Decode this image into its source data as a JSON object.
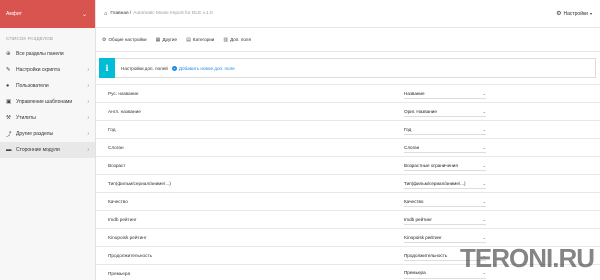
{
  "sidebar": {
    "brand": "Амфит",
    "caption": "СПИСОК РАЗДЕЛОВ",
    "items": [
      {
        "icon": "globe-icon",
        "glyph": "⊕",
        "label": "Все разделы панели",
        "arrow": ""
      },
      {
        "icon": "wrench-icon",
        "glyph": "✎",
        "label": "Настройки скрипта",
        "arrow": "›"
      },
      {
        "icon": "user-icon",
        "glyph": "●",
        "label": "Пользователи",
        "arrow": "›"
      },
      {
        "icon": "templates-icon",
        "glyph": "▣",
        "label": "Управление шаблонами",
        "arrow": "›"
      },
      {
        "icon": "tools-icon",
        "glyph": "⚒",
        "label": "Утилиты",
        "arrow": "›"
      },
      {
        "icon": "share-icon",
        "glyph": "⤴",
        "label": "Другие разделы",
        "arrow": "›"
      },
      {
        "icon": "module-icon",
        "glyph": "▬",
        "label": "Сторонние модули",
        "arrow": "›"
      }
    ]
  },
  "topbar": {
    "crumb_home": "Главная /",
    "crumb_current": "Automatic Movie Import for DLE v.1.0",
    "settings_label": "Настройки"
  },
  "tabs": [
    {
      "icon": "gear-icon",
      "glyph": "⚙",
      "label": "Общие настройки"
    },
    {
      "icon": "grid-icon",
      "glyph": "▦",
      "label": "Другие"
    },
    {
      "icon": "list-icon",
      "glyph": "▤",
      "label": "Категории"
    },
    {
      "icon": "fields-icon",
      "glyph": "▥",
      "label": "Доп. поля"
    }
  ],
  "info": {
    "text": "Настройки доп. полей",
    "link": "Добавить новое доп. поле"
  },
  "rows": [
    {
      "label": "Рус. название",
      "value": "Название"
    },
    {
      "label": "Англ. название",
      "value": "Ориг. Название"
    },
    {
      "label": "Год",
      "value": "Год"
    },
    {
      "label": "Слоган",
      "value": "Слоган"
    },
    {
      "label": "Возраст",
      "value": "Возрастные ограничения"
    },
    {
      "label": "Тип(фильм/сериал/аниме/...)",
      "value": "Тип(фильм/сериал/аниме/...)"
    },
    {
      "label": "Качество",
      "value": "Качество"
    },
    {
      "label": "Imdb рейтинг",
      "value": "Imdb рейтинг"
    },
    {
      "label": "Kinopoisk рейтинг",
      "value": "Kinopoisk рейтинг"
    },
    {
      "label": "Продолжительность",
      "value": "Продолжительность"
    },
    {
      "label": "Премьера",
      "value": "Премьера"
    }
  ],
  "watermark": "TERONI.RU"
}
